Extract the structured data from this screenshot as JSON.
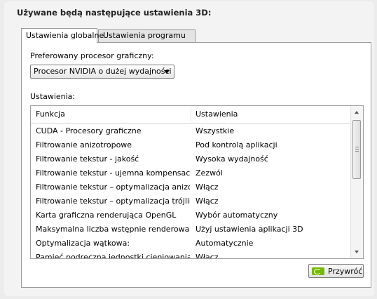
{
  "heading": "Używane będą następujące ustawienia 3D:",
  "tabs": [
    {
      "label": "Ustawienia globalne",
      "active": true
    },
    {
      "label": "Ustawienia programu",
      "active": false
    }
  ],
  "preferred_gpu": {
    "label": "Preferowany procesor graficzny:",
    "selected": "Procesor NVIDIA o dużej wydajności"
  },
  "settings": {
    "label": "Ustawienia:",
    "columns": [
      "Funkcja",
      "Ustawienia"
    ],
    "rows": [
      [
        "CUDA - Procesory graficzne",
        "Wszystkie"
      ],
      [
        "Filtrowanie anizotropowe",
        "Pod kontrolą aplikacji"
      ],
      [
        "Filtrowanie tekstur - jakość",
        "Wysoka wydajność"
      ],
      [
        "Filtrowanie tekstur - ujemna kompensacja ...",
        "Zezwól"
      ],
      [
        "Filtrowanie tekstur – optymalizacja anizotr...",
        "Włącz"
      ],
      [
        "Filtrowanie tekstur – optymalizacja trójlini...",
        "Włącz"
      ],
      [
        "Karta graficzna renderująca OpenGL",
        "Wybór automatyczny"
      ],
      [
        "Maksymalna liczba wstępnie renderowany...",
        "Użyj ustawienia aplikacji 3D"
      ],
      [
        "Optymalizacja wątkowa:",
        "Automatycznie"
      ],
      [
        "Pamięć podręczna jednostki cieniowania",
        "Włącz"
      ]
    ]
  },
  "restore_button": "Przywróć",
  "colors": {
    "nvidia_green": "#76b900"
  },
  "icons": [
    "chevron-down-icon",
    "scroll-up-icon",
    "scroll-down-icon",
    "nvidia-logo-icon"
  ]
}
